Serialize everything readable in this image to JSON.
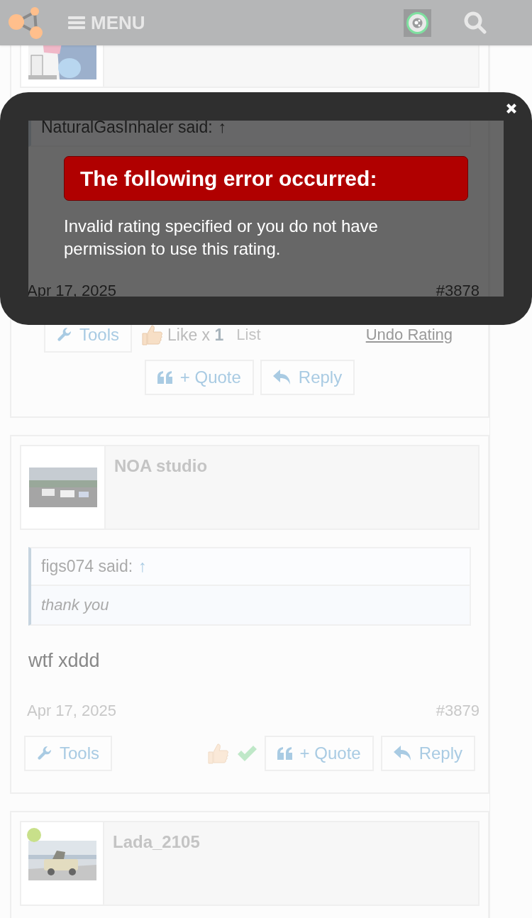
{
  "header": {
    "menu_label": "MENU"
  },
  "dialog": {
    "title": "The following error occurred:",
    "message": "Invalid rating specified or you do not have permission to use this rating."
  },
  "posts": [
    {
      "quote": {
        "author": "NaturalGasInhaler said:",
        "arrow": "↑"
      },
      "date": "Apr 17, 2025",
      "number": "#3878",
      "likes": {
        "summary": "Like x **1**",
        "list": "List",
        "undo": "Undo Rating"
      },
      "buttons": [
        {
          "kind": "tools",
          "label": "Tools"
        },
        {
          "kind": "quote",
          "label": "+ Quote"
        },
        {
          "kind": "reply",
          "label": "Reply"
        }
      ]
    },
    {
      "author": "NOA studio",
      "quote": {
        "author": "figs074 said:",
        "arrow": "↑",
        "body": "thank you"
      },
      "message": "wtf xddd",
      "date": "Apr 17, 2025",
      "number": "#3879",
      "can_rate": true,
      "buttons": [
        {
          "kind": "tools",
          "label": "Tools"
        },
        {
          "kind": "quote",
          "label": "+ Quote"
        },
        {
          "kind": "reply",
          "label": "Reply"
        }
      ]
    },
    {
      "author": "Lada_2105",
      "online": true
    }
  ]
}
